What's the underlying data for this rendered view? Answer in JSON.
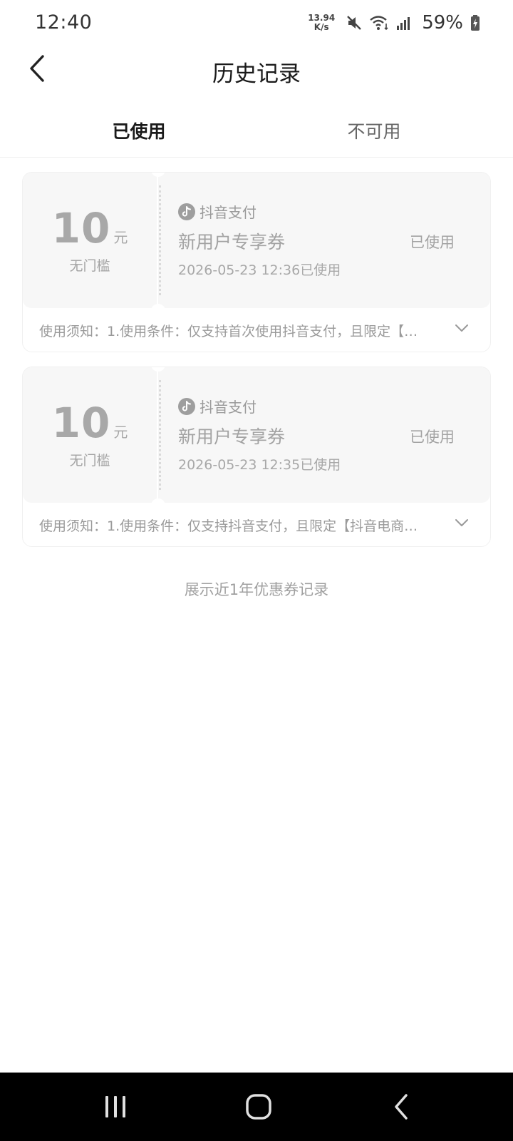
{
  "status_bar": {
    "time": "12:40",
    "net_speed_value": "13.94",
    "net_speed_unit": "K/s",
    "battery": "59%"
  },
  "header": {
    "title": "历史记录"
  },
  "tabs": [
    {
      "label": "已使用",
      "active": true
    },
    {
      "label": "不可用",
      "active": false
    }
  ],
  "coupons": [
    {
      "amount": "10",
      "unit": "元",
      "threshold": "无门槛",
      "brand": "抖音支付",
      "name": "新用户专享券",
      "date": "2026-05-23 12:36已使用",
      "status": "已使用",
      "notice": "使用须知：1.使用条件：仅支持首次使用抖音支付，且限定【…"
    },
    {
      "amount": "10",
      "unit": "元",
      "threshold": "无门槛",
      "brand": "抖音支付",
      "name": "新用户专享券",
      "date": "2026-05-23 12:35已使用",
      "status": "已使用",
      "notice": "使用须知：1.使用条件：仅支持抖音支付，且限定【抖音电商…"
    }
  ],
  "footer_note": "展示近1年优惠券记录",
  "icons": {
    "back": "chevron-left-icon",
    "mute": "mute-icon",
    "wifi": "wifi-icon",
    "signal": "signal-icon",
    "battery": "battery-charging-icon",
    "brand": "douyin-icon",
    "expand": "chevron-down-icon"
  },
  "colors": {
    "text_primary": "#1a1a1a",
    "text_muted": "#a3a3a3",
    "card_bg": "#f7f7f7",
    "nav_bg": "#000000"
  }
}
